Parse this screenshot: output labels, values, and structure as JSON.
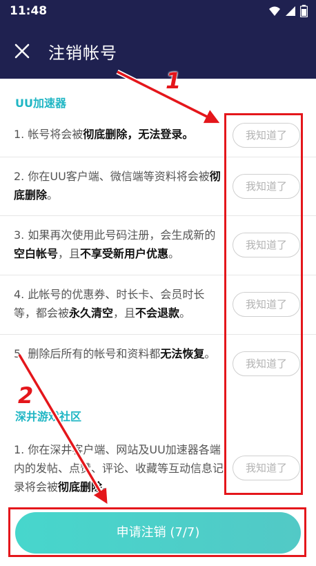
{
  "status_bar": {
    "time": "11:48"
  },
  "header": {
    "title": "注销帐号"
  },
  "sections": [
    {
      "title": "UU加速器",
      "items": [
        {
          "n": "1. ",
          "t1": "帐号将会被",
          "b1": "彻底删除，无法登录。",
          "t2": "",
          "b2": "",
          "t3": "",
          "ack": "我知道了"
        },
        {
          "n": "2. ",
          "t1": "你在UU客户端、微信端等资料将会被",
          "b1": "彻底删除",
          "t2": "。",
          "b2": "",
          "t3": "",
          "ack": "我知道了"
        },
        {
          "n": "3. ",
          "t1": "如果再次使用此号码注册，会生成新的",
          "b1": "空白帐号",
          "t2": "，且",
          "b2": "不享受新用户优惠",
          "t3": "。",
          "ack": "我知道了"
        },
        {
          "n": "4. ",
          "t1": "此帐号的优惠券、时长卡、会员时长等，都会被",
          "b1": "永久清空",
          "t2": "，且",
          "b2": "不会退款",
          "t3": "。",
          "ack": "我知道了"
        },
        {
          "n": "5. ",
          "t1": "删除后所有的帐号和资料都",
          "b1": "无法恢复",
          "t2": "。",
          "b2": "",
          "t3": "",
          "ack": "我知道了"
        }
      ]
    },
    {
      "title": "深井游戏社区",
      "items": [
        {
          "n": "1. ",
          "t1": "你在深井客户端、网站及UU加速器各端内的发帖、点赞、评论、收藏等互动信息记录将会被",
          "b1": "彻底删除",
          "t2": "。",
          "b2": "",
          "t3": "",
          "ack": "我知道了"
        }
      ]
    }
  ],
  "footer": {
    "submit_label": "申请注销 (7/7)"
  },
  "annotations": {
    "label_1": "1",
    "label_2": "2",
    "box_color": "#e4161b"
  },
  "colors": {
    "header_bg": "#1f2150",
    "accent": "#1fb6c4",
    "button": "#4fd2c8"
  }
}
